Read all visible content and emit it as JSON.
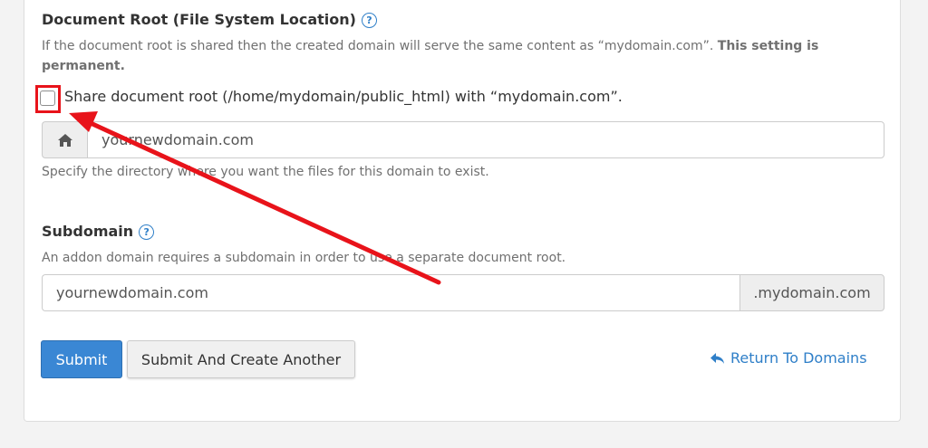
{
  "docroot": {
    "heading": "Document Root (File System Location)",
    "help_icon": "question-circle-icon",
    "description_prefix": "If the document root is shared then the created domain will serve the same content as “mydomain.com”. ",
    "description_bold": "This setting is permanent.",
    "share_checkbox_label": "Share document root (/home/mydomain/public_html) with “mydomain.com”.",
    "share_checked": false,
    "input_icon": "home-icon",
    "input_value": "yournewdomain.com",
    "hint": "Specify the directory where you want the files for this domain to exist."
  },
  "subdomain": {
    "heading": "Subdomain",
    "help_icon": "question-circle-icon",
    "description": "An addon domain requires a subdomain in order to use a separate document root.",
    "input_value": "yournewdomain.com",
    "suffix": ".mydomain.com"
  },
  "actions": {
    "submit_label": "Submit",
    "submit_another_label": "Submit And Create Another",
    "return_label": "Return To Domains",
    "return_icon": "reply-arrow-icon"
  },
  "annotation": {
    "color": "#e8131a"
  }
}
